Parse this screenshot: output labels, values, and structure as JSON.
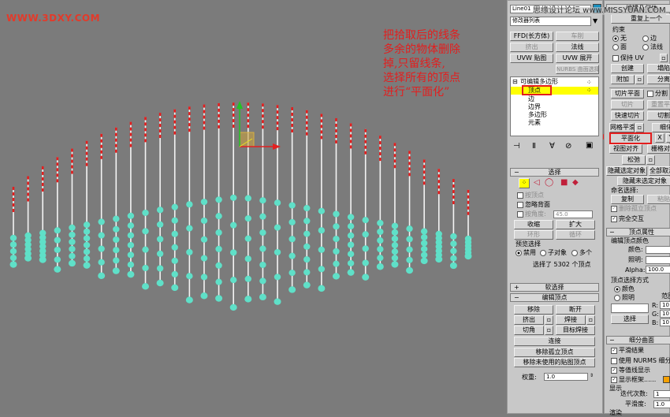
{
  "watermark_top": "WWW.3DXY.COM",
  "annotation": [
    "把拾取后的线条",
    "多余的物体删除",
    "掉,只留线条,",
    "选择所有的顶点",
    "进行“平面化”"
  ],
  "colors": {
    "accent_red": "#e31e1e",
    "vertex_cyan": "#5fe0c8",
    "selected_yellow": "#ffff00",
    "viewport_bg": "#7b7b7b",
    "panel_bg": "#c8c8c8"
  },
  "modifier_panel": {
    "object_name": "Line01",
    "modifier_list": "修改器列表",
    "header_watermark": "思缘设计论坛 www.MISSYUAN.COM",
    "buttons": {
      "ffd": "FFD(长方体)",
      "lathe": "车削",
      "extrude": "挤出",
      "normal": "法线",
      "uvw_map": "UVW 贴图",
      "uvw_unwrap": "UVW 展开",
      "nurbs_select": "NURBS 曲面选择"
    },
    "stack": {
      "root": "可编辑多边形",
      "items": [
        "顶点",
        "边",
        "边界",
        "多边形",
        "元素"
      ],
      "selected_index": 0
    }
  },
  "selection": {
    "title": "选择",
    "by_vertex": "按顶点",
    "ignore_backface": "忽略背面",
    "by_angle": "按角度:",
    "angle_value": "45.0",
    "shrink": "收缩",
    "grow": "扩大",
    "ring": "环形",
    "loop": "循环",
    "preview_title": "预览选择",
    "preview_options": [
      "禁用",
      "子对象",
      "多个"
    ],
    "status": "选择了 5302 个顶点"
  },
  "soft_selection": {
    "title": "软选择"
  },
  "edit_vertices": {
    "title": "编辑顶点",
    "remove": "移除",
    "break": "断开",
    "extrude": "挤出",
    "weld": "焊接",
    "chamfer": "切角",
    "target_weld": "目标焊接",
    "connect": "连接",
    "remove_isolated": "移除孤立顶点",
    "remove_unused_map": "移除未使用的贴图顶点",
    "weight_label": "权重:",
    "weight_value": "1.0"
  },
  "edit_geometry": {
    "title": "编辑几何体",
    "repeat_last": "重复上一个",
    "constraints": "约束",
    "c_none": "无",
    "c_edge": "边",
    "c_face": "面",
    "c_normal": "法线",
    "preserve_uv": "保持 UV",
    "create": "创建",
    "collapse": "塌陷",
    "attach": "附加",
    "detach": "分离",
    "slice_plane": "切片平面",
    "split": "分割",
    "slice": "切片",
    "reset_plane": "重置平面",
    "quickslice": "快速切片",
    "cut": "切割",
    "msmooth": "网格平滑",
    "tessellate": "细化",
    "make_planar": "平面化",
    "x": "X",
    "y": "Y",
    "view_align": "视图对齐",
    "grid_align": "栅格对齐",
    "relax": "松弛",
    "hide_selected": "隐藏选定对象",
    "unhide_all": "全部取消隐藏",
    "hide_unselected": "隐藏未选定对象",
    "named_sel": "命名选择:",
    "copy": "复制",
    "paste": "粘贴",
    "delete_isolated": "删除孤立顶点",
    "full_interactivity": "完全交互"
  },
  "vertex_properties": {
    "title": "顶点属性",
    "vertex_color": "编辑顶点颜色",
    "color": "颜色:",
    "illumination": "照明:",
    "alpha": "Alpha:",
    "alpha_value": "100.0",
    "select_by": "顶点选择方式",
    "by_color": "颜色",
    "by_illum": "照明",
    "range": "范围",
    "r": "R:",
    "g": "G:",
    "b": "B:",
    "rgb_value": "10",
    "select": "选择"
  },
  "subdivision": {
    "title": "细分曲面",
    "smooth_result": "平滑结果",
    "use_nurms": "使用 NURMS 细分",
    "isoline_display": "等值线显示",
    "show_cage": "显示框架......",
    "display": "显示",
    "iterations": "迭代次数:",
    "iterations_value": "1",
    "smoothness": "平滑度:",
    "smoothness_value": "1.0",
    "render": "渲染"
  }
}
